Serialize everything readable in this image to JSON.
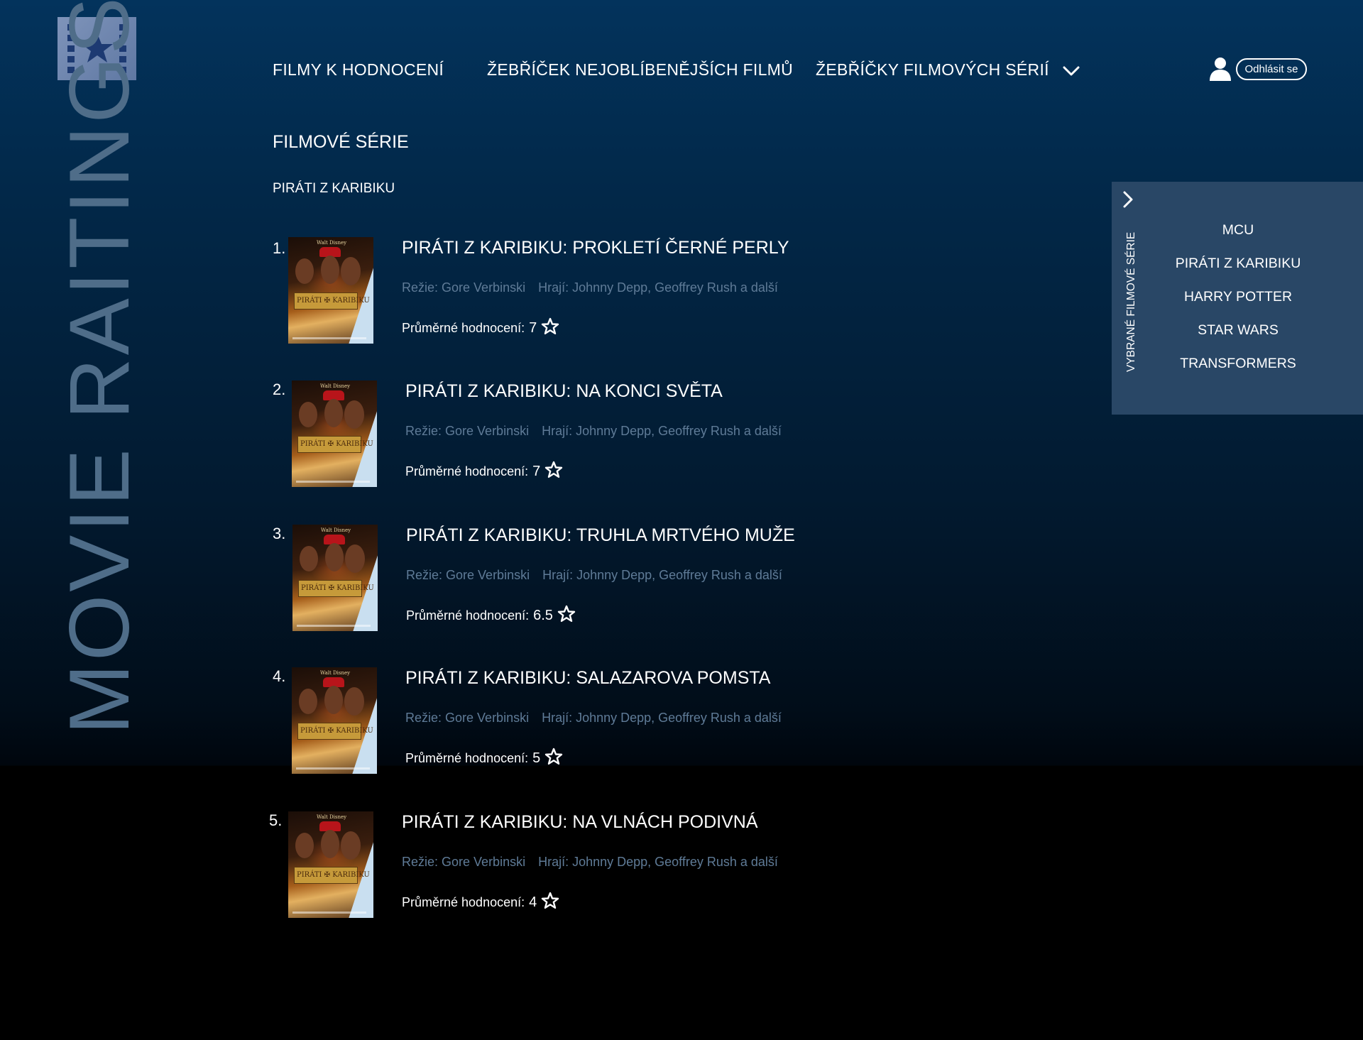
{
  "app": {
    "brand_text": "MOVIE RAITINGS",
    "logo_icon": "film-star-icon"
  },
  "nav": {
    "items": [
      {
        "label": "FILMY K HODNOCENÍ"
      },
      {
        "label": "ŽEBŘÍČEK NEJOBLÍBENĚJŠÍCH FILMŮ"
      },
      {
        "label": "ŽEBŘÍČKY FILMOVÝCH SÉRIÍ",
        "icon": "chevron-down-icon"
      }
    ],
    "user_icon": "user-icon",
    "logout_label": "Odhlásit se"
  },
  "page": {
    "title": "FILMOVÉ SÉRIE",
    "series_name": "PIRÁTI Z KARIBIKU"
  },
  "rating_label": "Průměrné hodnocení:",
  "movies": [
    {
      "rank": "1.",
      "title": "PIRÁTI Z KARIBIKU: PROKLETÍ ČERNÉ PERLY",
      "director": "Režie: Gore Verbinski",
      "cast": "Hrají: Johnny Depp, Geoffrey Rush a další",
      "rating": "7"
    },
    {
      "rank": "2.",
      "title": "PIRÁTI Z KARIBIKU: NA KONCI SVĚTA",
      "director": "Režie: Gore Verbinski",
      "cast": "Hrají: Johnny Depp, Geoffrey Rush a další",
      "rating": "7"
    },
    {
      "rank": "3.",
      "title": "PIRÁTI Z KARIBIKU: TRUHLA MRTVÉHO MUŽE",
      "director": "Režie: Gore Verbinski",
      "cast": "Hrají: Johnny Depp, Geoffrey Rush a další",
      "rating": "6.5"
    },
    {
      "rank": "4.",
      "title": "PIRÁTI Z KARIBIKU: SALAZAROVA POMSTA",
      "director": "Režie: Gore Verbinski",
      "cast": "Hrají: Johnny Depp, Geoffrey Rush a další",
      "rating": "5"
    },
    {
      "rank": "5.",
      "title": "PIRÁTI Z KARIBIKU: NA VLNÁCH PODIVNÁ",
      "director": "Režie: Gore Verbinski",
      "cast": "Hrají: Johnny Depp, Geoffrey Rush a další",
      "rating": "4"
    }
  ],
  "sidebar": {
    "label": "VYBRANÉ FILMOVÉ SÉRIE",
    "toggle_icon": "chevron-right-icon",
    "items": [
      {
        "label": "MCU"
      },
      {
        "label": "PIRÁTI Z KARIBIKU"
      },
      {
        "label": "HARRY POTTER"
      },
      {
        "label": "STAR WARS"
      },
      {
        "label": "TRANSFORMERS"
      }
    ]
  },
  "colors": {
    "background_top": "#03335c",
    "background_bottom": "#000000",
    "brand_text": "#4f6d89",
    "meta_text": "#5f7b97",
    "panel": "#294766"
  }
}
